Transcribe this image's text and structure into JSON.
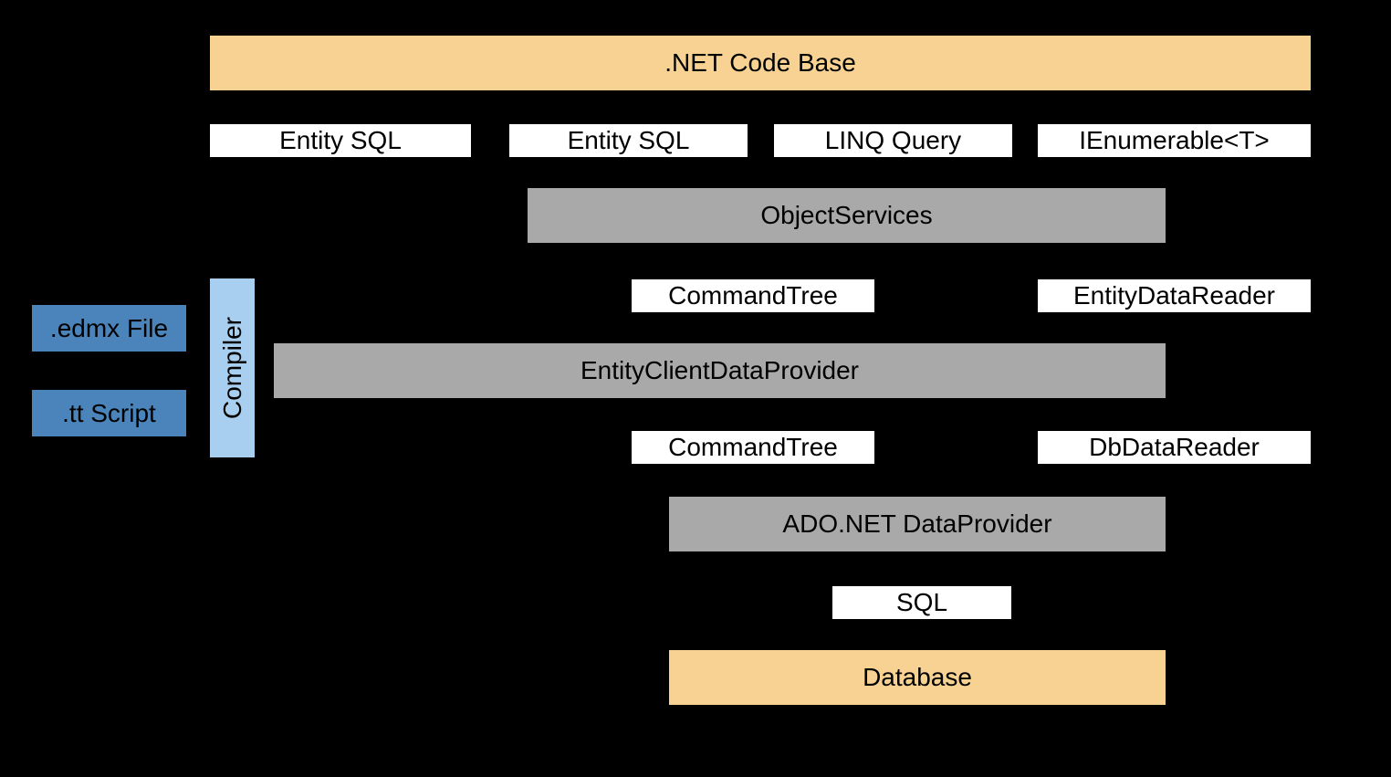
{
  "top": {
    "code_base": ".NET Code Base"
  },
  "row1": {
    "entity_sql_a": "Entity SQL",
    "entity_sql_b": "Entity SQL",
    "linq_query": "LINQ Query",
    "ienumerable": "IEnumerable<T>"
  },
  "layers": {
    "object_services": "ObjectServices",
    "entity_client": "EntityClientDataProvider",
    "ado_provider": "ADO.NET DataProvider",
    "database": "Database"
  },
  "mid1": {
    "command_tree_a": "CommandTree",
    "entity_reader": "EntityDataReader"
  },
  "mid2": {
    "command_tree_b": "CommandTree",
    "db_reader": "DbDataReader"
  },
  "mid3": {
    "sql": "SQL"
  },
  "left": {
    "edmx": ".edmx File",
    "tt": ".tt Script",
    "compiler": "Compiler"
  }
}
